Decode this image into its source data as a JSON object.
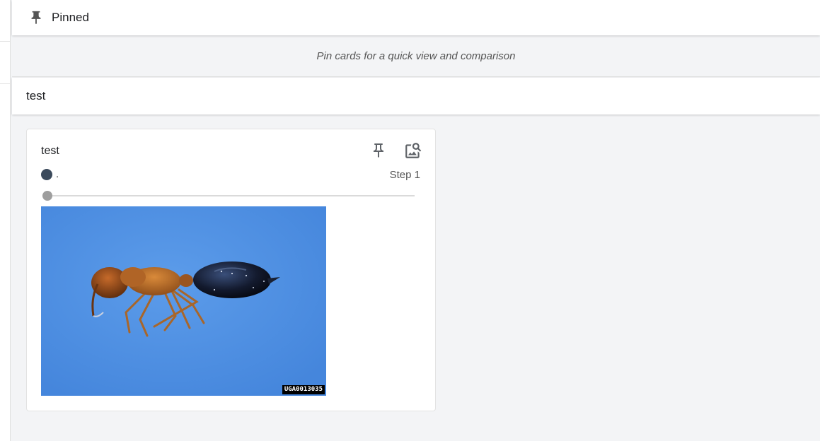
{
  "pinned_section": {
    "title": "Pinned",
    "empty_message": "Pin cards for a quick view and comparison"
  },
  "group": {
    "title": "test"
  },
  "card": {
    "title": "test",
    "run_name": ".",
    "run_color": "#3b4a5c",
    "step_label": "Step 1",
    "step_progress": 0,
    "image": {
      "subject": "ant specimen on blue background",
      "watermark": "UGA0013035"
    },
    "icons": {
      "pin": "pin-icon",
      "image_search": "image-search-icon"
    }
  },
  "colors": {
    "page_background": "#f3f4f6",
    "header_background": "#ffffff",
    "image_background": "#4f90e4"
  }
}
